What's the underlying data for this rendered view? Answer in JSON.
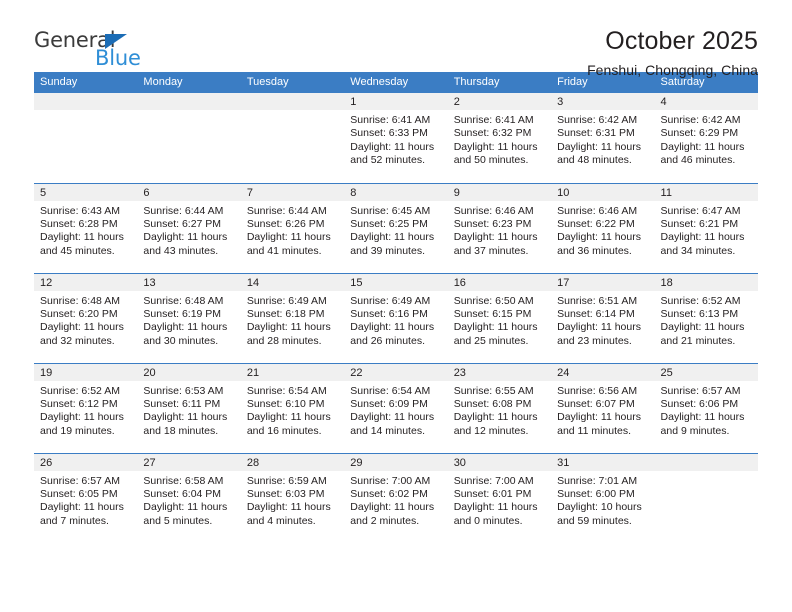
{
  "brand": {
    "name_top": "General",
    "name_bottom": "Blue",
    "accent_blue": "#2f8ed6",
    "triangle_blue": "#1b6cb5"
  },
  "header": {
    "title": "October 2025",
    "subtitle": "Fenshui, Chongqing, China"
  },
  "calendar": {
    "header_bg": "#3b7dc4",
    "daynum_bg": "#f0f0f0",
    "day_names": [
      "Sunday",
      "Monday",
      "Tuesday",
      "Wednesday",
      "Thursday",
      "Friday",
      "Saturday"
    ],
    "weeks": [
      [
        {
          "day": "",
          "sunrise": "",
          "sunset": "",
          "daylight_1": "",
          "daylight_2": ""
        },
        {
          "day": "",
          "sunrise": "",
          "sunset": "",
          "daylight_1": "",
          "daylight_2": ""
        },
        {
          "day": "",
          "sunrise": "",
          "sunset": "",
          "daylight_1": "",
          "daylight_2": ""
        },
        {
          "day": "1",
          "sunrise": "Sunrise: 6:41 AM",
          "sunset": "Sunset: 6:33 PM",
          "daylight_1": "Daylight: 11 hours",
          "daylight_2": "and 52 minutes."
        },
        {
          "day": "2",
          "sunrise": "Sunrise: 6:41 AM",
          "sunset": "Sunset: 6:32 PM",
          "daylight_1": "Daylight: 11 hours",
          "daylight_2": "and 50 minutes."
        },
        {
          "day": "3",
          "sunrise": "Sunrise: 6:42 AM",
          "sunset": "Sunset: 6:31 PM",
          "daylight_1": "Daylight: 11 hours",
          "daylight_2": "and 48 minutes."
        },
        {
          "day": "4",
          "sunrise": "Sunrise: 6:42 AM",
          "sunset": "Sunset: 6:29 PM",
          "daylight_1": "Daylight: 11 hours",
          "daylight_2": "and 46 minutes."
        }
      ],
      [
        {
          "day": "5",
          "sunrise": "Sunrise: 6:43 AM",
          "sunset": "Sunset: 6:28 PM",
          "daylight_1": "Daylight: 11 hours",
          "daylight_2": "and 45 minutes."
        },
        {
          "day": "6",
          "sunrise": "Sunrise: 6:44 AM",
          "sunset": "Sunset: 6:27 PM",
          "daylight_1": "Daylight: 11 hours",
          "daylight_2": "and 43 minutes."
        },
        {
          "day": "7",
          "sunrise": "Sunrise: 6:44 AM",
          "sunset": "Sunset: 6:26 PM",
          "daylight_1": "Daylight: 11 hours",
          "daylight_2": "and 41 minutes."
        },
        {
          "day": "8",
          "sunrise": "Sunrise: 6:45 AM",
          "sunset": "Sunset: 6:25 PM",
          "daylight_1": "Daylight: 11 hours",
          "daylight_2": "and 39 minutes."
        },
        {
          "day": "9",
          "sunrise": "Sunrise: 6:46 AM",
          "sunset": "Sunset: 6:23 PM",
          "daylight_1": "Daylight: 11 hours",
          "daylight_2": "and 37 minutes."
        },
        {
          "day": "10",
          "sunrise": "Sunrise: 6:46 AM",
          "sunset": "Sunset: 6:22 PM",
          "daylight_1": "Daylight: 11 hours",
          "daylight_2": "and 36 minutes."
        },
        {
          "day": "11",
          "sunrise": "Sunrise: 6:47 AM",
          "sunset": "Sunset: 6:21 PM",
          "daylight_1": "Daylight: 11 hours",
          "daylight_2": "and 34 minutes."
        }
      ],
      [
        {
          "day": "12",
          "sunrise": "Sunrise: 6:48 AM",
          "sunset": "Sunset: 6:20 PM",
          "daylight_1": "Daylight: 11 hours",
          "daylight_2": "and 32 minutes."
        },
        {
          "day": "13",
          "sunrise": "Sunrise: 6:48 AM",
          "sunset": "Sunset: 6:19 PM",
          "daylight_1": "Daylight: 11 hours",
          "daylight_2": "and 30 minutes."
        },
        {
          "day": "14",
          "sunrise": "Sunrise: 6:49 AM",
          "sunset": "Sunset: 6:18 PM",
          "daylight_1": "Daylight: 11 hours",
          "daylight_2": "and 28 minutes."
        },
        {
          "day": "15",
          "sunrise": "Sunrise: 6:49 AM",
          "sunset": "Sunset: 6:16 PM",
          "daylight_1": "Daylight: 11 hours",
          "daylight_2": "and 26 minutes."
        },
        {
          "day": "16",
          "sunrise": "Sunrise: 6:50 AM",
          "sunset": "Sunset: 6:15 PM",
          "daylight_1": "Daylight: 11 hours",
          "daylight_2": "and 25 minutes."
        },
        {
          "day": "17",
          "sunrise": "Sunrise: 6:51 AM",
          "sunset": "Sunset: 6:14 PM",
          "daylight_1": "Daylight: 11 hours",
          "daylight_2": "and 23 minutes."
        },
        {
          "day": "18",
          "sunrise": "Sunrise: 6:52 AM",
          "sunset": "Sunset: 6:13 PM",
          "daylight_1": "Daylight: 11 hours",
          "daylight_2": "and 21 minutes."
        }
      ],
      [
        {
          "day": "19",
          "sunrise": "Sunrise: 6:52 AM",
          "sunset": "Sunset: 6:12 PM",
          "daylight_1": "Daylight: 11 hours",
          "daylight_2": "and 19 minutes."
        },
        {
          "day": "20",
          "sunrise": "Sunrise: 6:53 AM",
          "sunset": "Sunset: 6:11 PM",
          "daylight_1": "Daylight: 11 hours",
          "daylight_2": "and 18 minutes."
        },
        {
          "day": "21",
          "sunrise": "Sunrise: 6:54 AM",
          "sunset": "Sunset: 6:10 PM",
          "daylight_1": "Daylight: 11 hours",
          "daylight_2": "and 16 minutes."
        },
        {
          "day": "22",
          "sunrise": "Sunrise: 6:54 AM",
          "sunset": "Sunset: 6:09 PM",
          "daylight_1": "Daylight: 11 hours",
          "daylight_2": "and 14 minutes."
        },
        {
          "day": "23",
          "sunrise": "Sunrise: 6:55 AM",
          "sunset": "Sunset: 6:08 PM",
          "daylight_1": "Daylight: 11 hours",
          "daylight_2": "and 12 minutes."
        },
        {
          "day": "24",
          "sunrise": "Sunrise: 6:56 AM",
          "sunset": "Sunset: 6:07 PM",
          "daylight_1": "Daylight: 11 hours",
          "daylight_2": "and 11 minutes."
        },
        {
          "day": "25",
          "sunrise": "Sunrise: 6:57 AM",
          "sunset": "Sunset: 6:06 PM",
          "daylight_1": "Daylight: 11 hours",
          "daylight_2": "and 9 minutes."
        }
      ],
      [
        {
          "day": "26",
          "sunrise": "Sunrise: 6:57 AM",
          "sunset": "Sunset: 6:05 PM",
          "daylight_1": "Daylight: 11 hours",
          "daylight_2": "and 7 minutes."
        },
        {
          "day": "27",
          "sunrise": "Sunrise: 6:58 AM",
          "sunset": "Sunset: 6:04 PM",
          "daylight_1": "Daylight: 11 hours",
          "daylight_2": "and 5 minutes."
        },
        {
          "day": "28",
          "sunrise": "Sunrise: 6:59 AM",
          "sunset": "Sunset: 6:03 PM",
          "daylight_1": "Daylight: 11 hours",
          "daylight_2": "and 4 minutes."
        },
        {
          "day": "29",
          "sunrise": "Sunrise: 7:00 AM",
          "sunset": "Sunset: 6:02 PM",
          "daylight_1": "Daylight: 11 hours",
          "daylight_2": "and 2 minutes."
        },
        {
          "day": "30",
          "sunrise": "Sunrise: 7:00 AM",
          "sunset": "Sunset: 6:01 PM",
          "daylight_1": "Daylight: 11 hours",
          "daylight_2": "and 0 minutes."
        },
        {
          "day": "31",
          "sunrise": "Sunrise: 7:01 AM",
          "sunset": "Sunset: 6:00 PM",
          "daylight_1": "Daylight: 10 hours",
          "daylight_2": "and 59 minutes."
        },
        {
          "day": "",
          "sunrise": "",
          "sunset": "",
          "daylight_1": "",
          "daylight_2": ""
        }
      ]
    ]
  }
}
